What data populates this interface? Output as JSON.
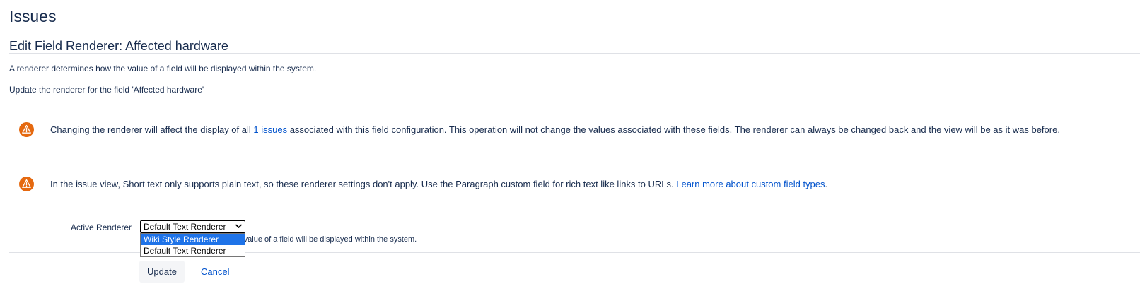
{
  "header": {
    "title": "Issues"
  },
  "section": {
    "title": "Edit Field Renderer: Affected hardware",
    "description": "A renderer determines how the value of a field will be displayed within the system.",
    "update_note": "Update the renderer for the field 'Affected hardware'"
  },
  "warnings": [
    {
      "icon": "warning-icon",
      "text_before": "Changing the renderer will affect the display of all ",
      "link_text": "1 issues",
      "text_after": " associated with this field configuration. This operation will not change the values associated with these fields. The renderer can always be changed back and the view will be as it was before."
    },
    {
      "icon": "warning-icon",
      "text_before": "In the issue view, Short text only supports plain text, so these renderer settings don't apply. Use the Paragraph custom field for rich text like links to URLs. ",
      "link_text": "Learn more about custom field types",
      "text_after": "."
    }
  ],
  "form": {
    "field_label": "Active Renderer",
    "selected_value": "Default Text Renderer",
    "options": [
      "Wiki Style Renderer",
      "Default Text Renderer"
    ],
    "highlighted_option": "Wiki Style Renderer",
    "helper_text_visible": "e value of a field will be displayed within the system.",
    "update_label": "Update",
    "cancel_label": "Cancel"
  },
  "colors": {
    "text": "#172b4d",
    "link": "#0052cc",
    "warning": "#e56910",
    "option_highlight": "#1e73e8",
    "button_bg": "#f4f5f7",
    "divider": "#dfe1e6"
  }
}
